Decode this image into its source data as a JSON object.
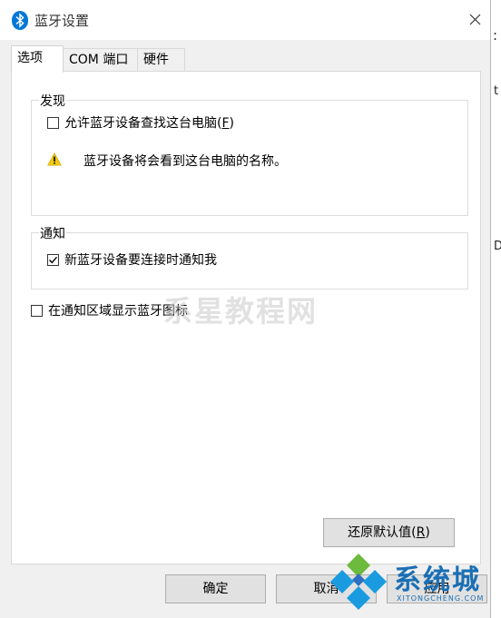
{
  "window": {
    "title": "蓝牙设置",
    "close_glyph": "✕"
  },
  "tabs": [
    {
      "label": "选项",
      "active": true
    },
    {
      "label": "COM 端口",
      "active": false
    },
    {
      "label": "硬件",
      "active": false
    }
  ],
  "discovery": {
    "legend": "发现",
    "allow_find_label": "允许蓝牙设备查找这台电脑(",
    "allow_find_key": "F",
    "allow_find_end": ")",
    "allow_find_checked": false,
    "warning_text": "蓝牙设备将会看到这台电脑的名称。"
  },
  "notification": {
    "legend": "通知",
    "notify_label": "新蓝牙设备要连接时通知我",
    "notify_checked": true
  },
  "tray_icon": {
    "label": "在通知区域显示蓝牙图标",
    "checked": false
  },
  "restore_button": {
    "label": "还原默认值(",
    "key": "R",
    "end": ")"
  },
  "footer": {
    "ok_label": "确定",
    "cancel_label": "取消",
    "apply_label": "应用"
  },
  "watermark": "系星教程网",
  "site_logo": {
    "name": "系统城",
    "url_text": "XITONGCHENG.COM"
  },
  "colors": {
    "accent_blue": "#0078d7",
    "warning_yellow": "#f2c811",
    "logo_blue": "#1a6fb5"
  }
}
